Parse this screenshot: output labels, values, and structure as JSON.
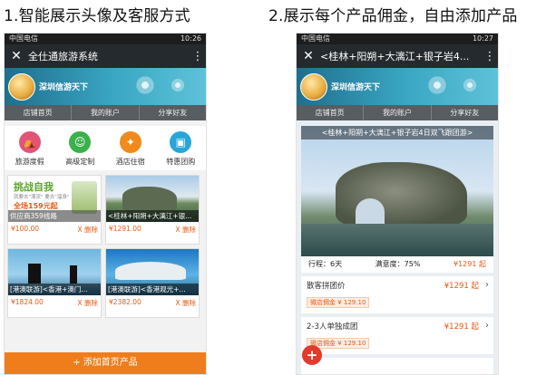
{
  "captions": {
    "left": "1.智能展示头像及客服方式",
    "right": "2.展示每个产品佣金，自由添加产品"
  },
  "left": {
    "status": {
      "carrier": "中国电信",
      "time": "10:26"
    },
    "title": "全仕通旅游系统",
    "shop_name": "深圳信游天下",
    "nav": [
      "店铺首页",
      "我的账户",
      "分享好友"
    ],
    "categories": [
      {
        "label": "旅游度假",
        "icon": "tent-icon",
        "color": "#e25477"
      },
      {
        "label": "高级定制",
        "icon": "person-icon",
        "color": "#3bb14a"
      },
      {
        "label": "酒店住宿",
        "icon": "compass-icon",
        "color": "#f08a1c"
      },
      {
        "label": "特惠团购",
        "icon": "car-icon",
        "color": "#2aa5d8"
      }
    ],
    "cards": [
      {
        "caption": "供应商359线路",
        "price": "¥100.00",
        "del": "X 删除",
        "promo_title": "挑战自我",
        "promo_sub": "就要去\"漂流\" 要去\"溜身\"",
        "promo_price": "全场159元起"
      },
      {
        "caption": "<桂林+阳朔+大漓江+银...",
        "price": "¥1291.00",
        "del": "X 删除"
      },
      {
        "caption": "[港澳联游]<香港+澳门...",
        "price": "¥1824.00",
        "del": "X 删除"
      },
      {
        "caption": "[港澳联游]<香港观光+...",
        "price": "¥2382.00",
        "del": "X 删除"
      }
    ],
    "add_label": "+ 添加首页产品"
  },
  "right": {
    "status": {
      "carrier": "中国电信",
      "time": "10:27"
    },
    "title": "<桂林+阳朔+大漓江+银子岩4...",
    "shop_name": "深圳信游天下",
    "nav": [
      "店铺首页",
      "我的账户",
      "分享好友"
    ],
    "image_caption": "<桂林+阳朔+大漓江+银子岩4日双飞跟团游>",
    "info": {
      "duration": "行程：6天",
      "satisfaction": "满意度：75%",
      "price": "¥1291 起"
    },
    "options": [
      {
        "name": "散客拼团价",
        "price": "¥1291 起",
        "commission": "微店佣金 ¥ 129.10"
      },
      {
        "name": "2-3人单独成团",
        "price": "¥1291 起",
        "commission": "微店佣金 ¥ 129.10"
      }
    ],
    "fab_label": "+"
  }
}
